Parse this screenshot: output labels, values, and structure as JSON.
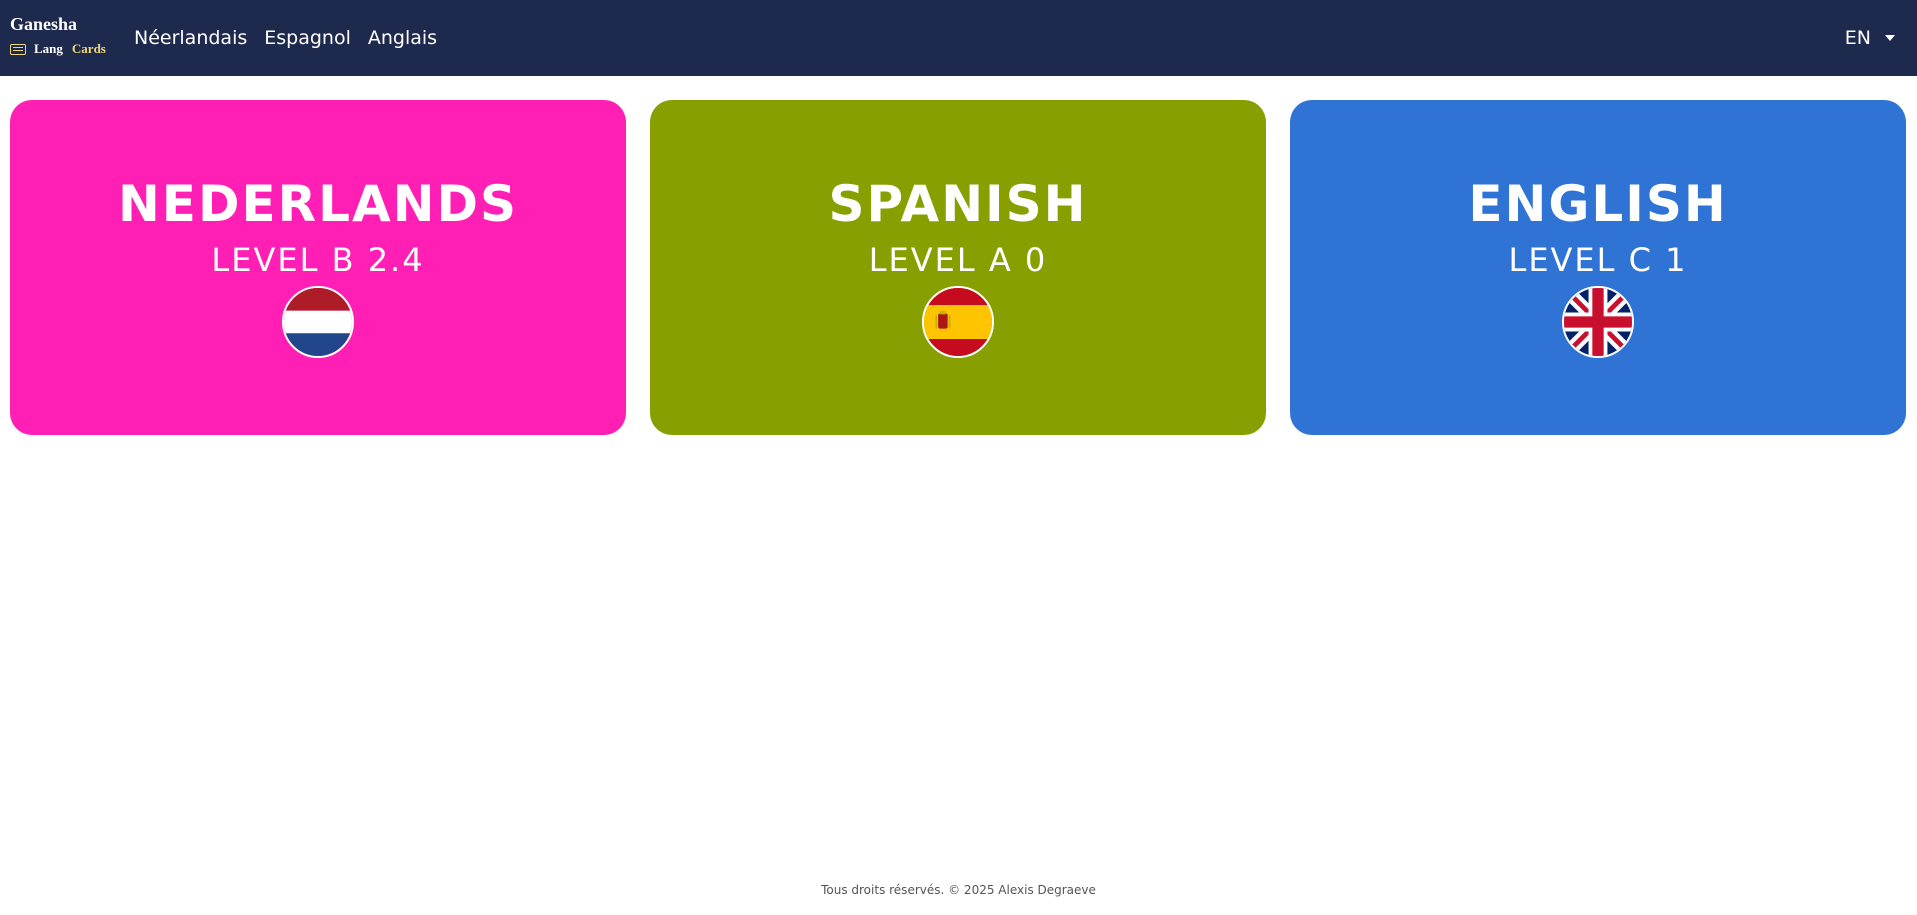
{
  "brand": {
    "title": "Ganesha",
    "lang_word": "Lang",
    "cards_word": "Cards",
    "icon": "book-icon",
    "accent_color": "#f0d879"
  },
  "nav": {
    "items": [
      {
        "label": "Néerlandais"
      },
      {
        "label": "Espagnol"
      },
      {
        "label": "Anglais"
      }
    ],
    "language_selector": "EN",
    "background": "#1e2a4d"
  },
  "cards": [
    {
      "title": "Nederlands",
      "level": "Level B 2.4",
      "color": "#ff1fb4",
      "flag": "netherlands-flag-icon"
    },
    {
      "title": "Spanish",
      "level": "Level A 0",
      "color": "#87a000",
      "flag": "spain-flag-icon"
    },
    {
      "title": "English",
      "level": "Level C 1",
      "color": "#2f73d5",
      "flag": "uk-flag-icon"
    }
  ],
  "footer": {
    "text": "Tous droits réservés. © 2025 Alexis Degraeve"
  }
}
